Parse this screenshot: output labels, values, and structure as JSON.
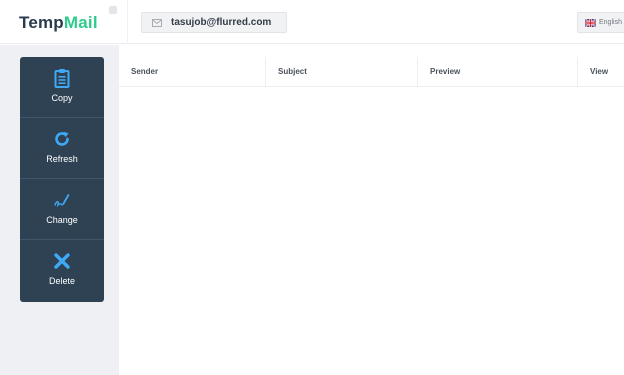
{
  "brand": {
    "part1": "Temp",
    "part2": "Mail"
  },
  "email": {
    "address": "tasujob@flurred.com",
    "icon": "envelope-icon"
  },
  "language": {
    "label": "English",
    "icon": "uk-flag-icon"
  },
  "actions": [
    {
      "label": "Copy",
      "icon": "clipboard-icon"
    },
    {
      "label": "Refresh",
      "icon": "refresh-icon"
    },
    {
      "label": "Change",
      "icon": "pen-icon"
    },
    {
      "label": "Delete",
      "icon": "close-icon"
    }
  ],
  "table": {
    "columns": [
      "Sender",
      "Subject",
      "Preview",
      "View"
    ]
  },
  "colors": {
    "brand_dark": "#2b3a4c",
    "brand_green": "#2ecc8b",
    "panel": "#2e4254",
    "icon_blue": "#3fa9f5"
  }
}
